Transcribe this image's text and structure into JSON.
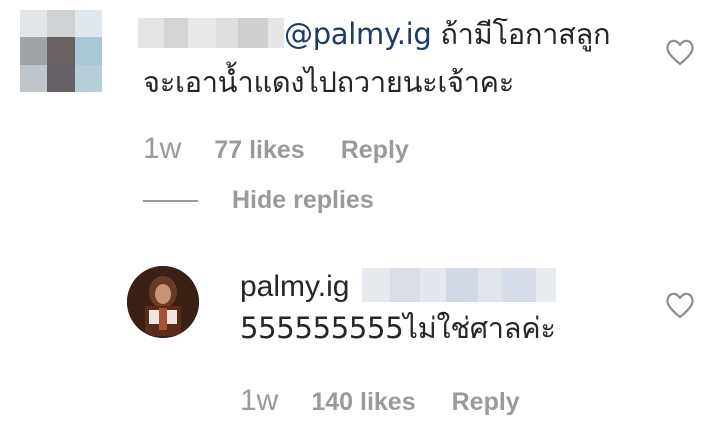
{
  "comment": {
    "mention": "@palmy.ig",
    "text_line1": "ถ้ามีโอกาสลูก",
    "text_line2": "จะเอาน้ำแดงไปถวายนะเจ้าคะ",
    "time": "1w",
    "likes": "77 likes",
    "reply_label": "Reply",
    "hide_replies_label": "Hide replies"
  },
  "reply": {
    "username": "palmy.ig",
    "text": "555555555ไม่ใช่ศาลค่ะ",
    "time": "1w",
    "likes": "140 likes",
    "reply_label": "Reply"
  },
  "icons": {
    "like": "heart-outline-icon"
  },
  "colors": {
    "mention": "#1b3a6b",
    "meta_text": "#9a9a9a",
    "primary_text": "#262626",
    "heart_stroke": "#8e8e8e"
  }
}
